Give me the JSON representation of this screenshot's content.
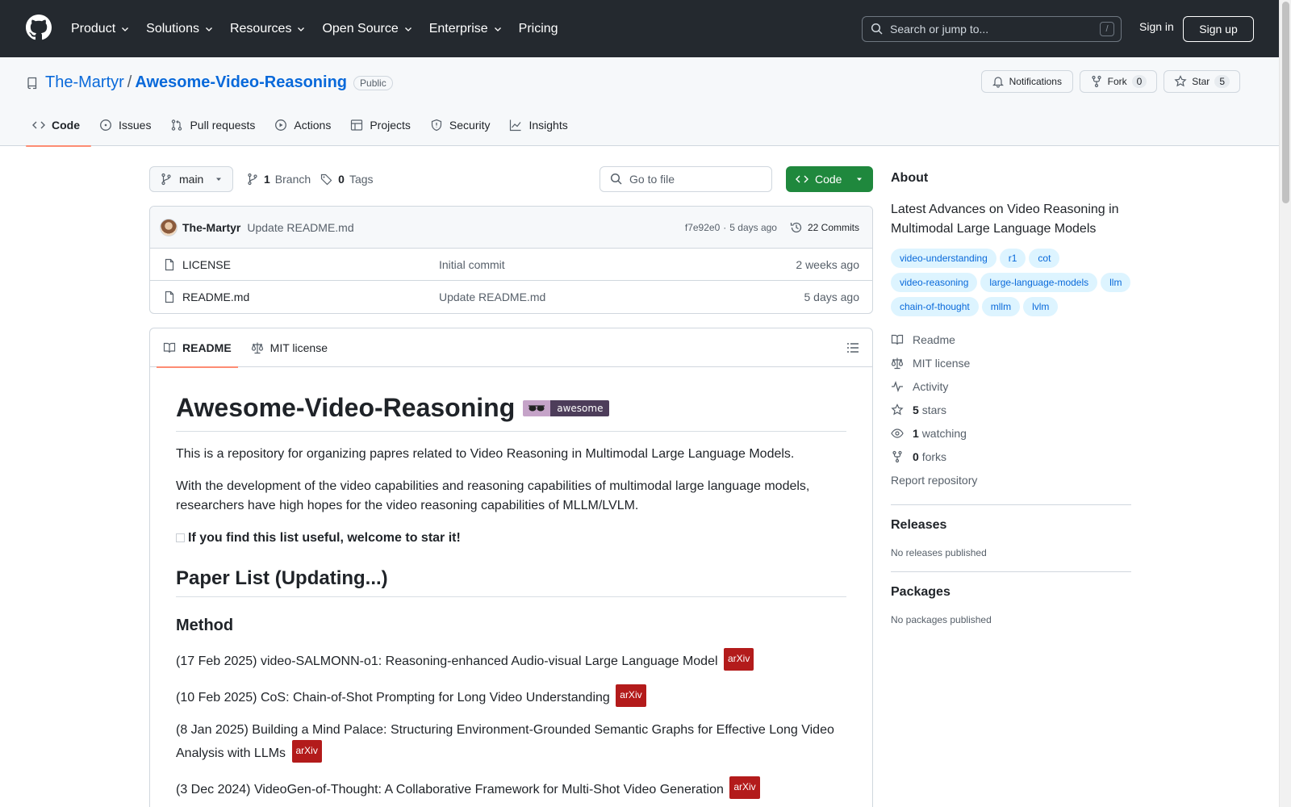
{
  "header": {
    "nav": [
      {
        "label": "Product",
        "has_caret": true
      },
      {
        "label": "Solutions",
        "has_caret": true
      },
      {
        "label": "Resources",
        "has_caret": true
      },
      {
        "label": "Open Source",
        "has_caret": true
      },
      {
        "label": "Enterprise",
        "has_caret": true
      },
      {
        "label": "Pricing",
        "has_caret": false
      }
    ],
    "search_placeholder": "Search or jump to...",
    "search_shortcut": "/",
    "sign_in": "Sign in",
    "sign_up": "Sign up"
  },
  "repo": {
    "owner": "The-Martyr",
    "separator": "/",
    "name": "Awesome-Video-Reasoning",
    "visibility": "Public",
    "actions": {
      "notifications": "Notifications",
      "fork": "Fork",
      "fork_count": "0",
      "star": "Star",
      "star_count": "5"
    },
    "tabs": [
      "Code",
      "Issues",
      "Pull requests",
      "Actions",
      "Projects",
      "Security",
      "Insights"
    ],
    "active_tab": "Code"
  },
  "toolbar": {
    "branch": "main",
    "branch_count": "1",
    "branch_label": "Branch",
    "tag_count": "0",
    "tag_label": "Tags",
    "goto_placeholder": "Go to file",
    "code_button": "Code"
  },
  "latest_commit": {
    "author": "The-Martyr",
    "message": "Update README.md",
    "hash": "f7e92e0",
    "dot": "·",
    "time": "5 days ago",
    "commits": "22 Commits"
  },
  "files": [
    {
      "name": "LICENSE",
      "message": "Initial commit",
      "date": "2 weeks ago"
    },
    {
      "name": "README.md",
      "message": "Update README.md",
      "date": "5 days ago"
    }
  ],
  "readme": {
    "tabs": [
      "README",
      "MIT license"
    ],
    "title": "Awesome-Video-Reasoning",
    "badge": "awesome",
    "intro": "This is a repository for organizing papres related to Video Reasoning in Multimodal Large Language Models.",
    "para2": "With the development of the video capabilities and reasoning capabilities of multimodal large language models, researchers have high hopes for the video reasoning capabilities of MLLM/LVLM.",
    "star_note": "If you find this list useful, welcome to star it!",
    "h2": "Paper List (Updating...)",
    "h3": "Method",
    "arxiv_label": "arXiv",
    "papers": [
      "(17 Feb 2025) video-SALMONN-o1: Reasoning-enhanced Audio-visual Large Language Model",
      "(10 Feb 2025) CoS: Chain-of-Shot Prompting for Long Video Understanding",
      "(8 Jan 2025) Building a Mind Palace: Structuring Environment-Grounded Semantic Graphs for Effective Long Video Analysis with LLMs",
      "(3 Dec 2024) VideoGen-of-Thought: A Collaborative Framework for Multi-Shot Video Generation"
    ]
  },
  "sidebar": {
    "about_title": "About",
    "description": "Latest Advances on Video Reasoning in Multimodal Large Language Models",
    "topics": [
      "video-understanding",
      "r1",
      "cot",
      "video-reasoning",
      "large-language-models",
      "llm",
      "chain-of-thought",
      "mllm",
      "lvlm"
    ],
    "links": {
      "readme": "Readme",
      "license": "MIT license",
      "activity": "Activity",
      "stars_count": "5",
      "stars_label": "stars",
      "watching_count": "1",
      "watching_label": "watching",
      "forks_count": "0",
      "forks_label": "forks",
      "report": "Report repository"
    },
    "releases_title": "Releases",
    "releases_empty": "No releases published",
    "packages_title": "Packages",
    "packages_empty": "No packages published"
  },
  "colors": {
    "header_bg": "#24292f",
    "link": "#0969da",
    "code_button": "#1f883d",
    "active_tab_underline": "#fd8c73",
    "arxiv_badge": "#b31b1b"
  }
}
